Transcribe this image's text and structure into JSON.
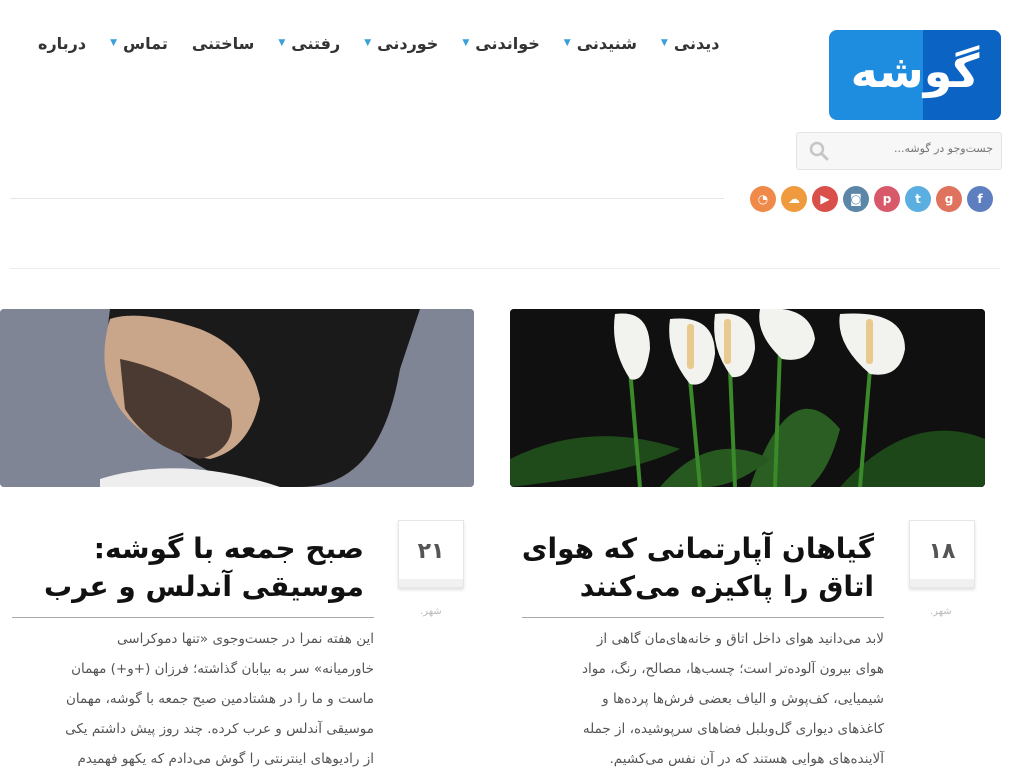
{
  "logo": {
    "text": "گوشه"
  },
  "nav": {
    "items": [
      {
        "label": "دیدنی",
        "has_submenu": true
      },
      {
        "label": "شنیدنی",
        "has_submenu": true
      },
      {
        "label": "خواندنی",
        "has_submenu": true
      },
      {
        "label": "خوردنی",
        "has_submenu": true
      },
      {
        "label": "رفتنی",
        "has_submenu": true
      },
      {
        "label": "ساختنی",
        "has_submenu": false
      },
      {
        "label": "تماس",
        "has_submenu": true
      },
      {
        "label": "درباره",
        "has_submenu": false
      }
    ]
  },
  "search": {
    "placeholder": "جست‌وجو در گوشه..."
  },
  "social": [
    {
      "name": "facebook-icon",
      "glyph": "f",
      "color": "#5d7fc0"
    },
    {
      "name": "google-plus-icon",
      "glyph": "g",
      "color": "#e0735e"
    },
    {
      "name": "twitter-icon",
      "glyph": "t",
      "color": "#5aaee0"
    },
    {
      "name": "pinterest-icon",
      "glyph": "p",
      "color": "#d85a6a"
    },
    {
      "name": "instagram-icon",
      "glyph": "◙",
      "color": "#5b86a7"
    },
    {
      "name": "youtube-icon",
      "glyph": "▶",
      "color": "#d9504a"
    },
    {
      "name": "soundcloud-icon",
      "glyph": "☁",
      "color": "#f09a3e"
    },
    {
      "name": "rss-icon",
      "glyph": "◔",
      "color": "#ef8a4a"
    }
  ],
  "posts": [
    {
      "day": "۱۸",
      "month": "شهر.",
      "title_line1": "گیاهان آپارتمانی که هوای",
      "title_line2": "اتاق را پاکیزه می‌کنند",
      "excerpt": [
        "لابد می‌دانید هوای داخل اتاق و خانه‌های‌مان گاهی از",
        "هوای بیرون آلوده‌تر است؛ چسب‌ها، مصالح، رنگ، مواد",
        "شیمیایی، کف‌پوش و الیاف بعضی فرش‌ها پرده‌ها و",
        "کاغذهای دیواری گل‌وبلبل فضاهای سرپوشیده، از جمله",
        "آلاینده‌های هوایی هستند که در آن نفس می‌کشیم."
      ]
    },
    {
      "day": "۲۱",
      "month": "شهر.",
      "title_line1": "صبح جمعه با گوشه:",
      "title_line2": "موسیقی آندلس و عرب",
      "excerpt": [
        "این هفته نمرا در جست‌وجوی «تنها دموکراسی",
        "خاورمیانه» سر به بیابان گذاشته؛ فرزان (+و+) مهمان",
        "ماست و ما را در هشتادمین صبح جمعه با گوشه، مهمان",
        "موسیقی آندلس و عرب کرده. چند روز پیش داشتم یکی",
        "از رادیوهای اینترنتی را گوش می‌دادم که یکهو فهمیدم"
      ]
    }
  ]
}
